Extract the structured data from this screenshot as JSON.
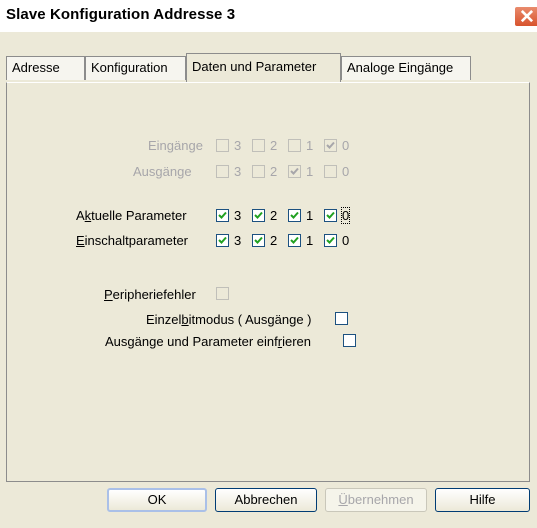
{
  "window": {
    "title": "Slave Konfiguration Addresse 3"
  },
  "tabs": [
    {
      "label": "Adresse",
      "active": false
    },
    {
      "label": "Konfiguration",
      "active": false
    },
    {
      "label": "Daten und Parameter",
      "active": true
    },
    {
      "label": "Analoge Eingänge",
      "active": false
    }
  ],
  "rows": {
    "eingaenge": {
      "label": "Eingänge",
      "enabled": false,
      "bits": [
        {
          "num": "3",
          "checked": false
        },
        {
          "num": "2",
          "checked": false
        },
        {
          "num": "1",
          "checked": false
        },
        {
          "num": "0",
          "checked": true
        }
      ]
    },
    "ausgaenge": {
      "label": "Ausgänge",
      "enabled": false,
      "bits": [
        {
          "num": "3",
          "checked": false
        },
        {
          "num": "2",
          "checked": true
        },
        {
          "num": "1",
          "checked": false
        },
        {
          "num": "0",
          "checked": false
        }
      ]
    },
    "aktuelle": {
      "label_pre": "A",
      "label_u": "k",
      "label_post": "tuelle Parameter",
      "enabled": true,
      "bits": [
        {
          "num": "3",
          "checked": true
        },
        {
          "num": "2",
          "checked": true
        },
        {
          "num": "1",
          "checked": true
        },
        {
          "num": "0",
          "checked": true
        }
      ]
    },
    "einschalt": {
      "label_u": "E",
      "label_post": "inschaltparameter",
      "enabled": true,
      "bits": [
        {
          "num": "3",
          "checked": true
        },
        {
          "num": "2",
          "checked": true
        },
        {
          "num": "1",
          "checked": true
        },
        {
          "num": "0",
          "checked": true
        }
      ]
    }
  },
  "options": {
    "peripherie": {
      "label_u": "P",
      "label_post": "eripheriefehler",
      "checked": false,
      "enabled": false
    },
    "einzelbit": {
      "label_pre": "Einzel",
      "label_u": "b",
      "label_post": "itmodus ( Ausgänge )",
      "checked": false,
      "enabled": true
    },
    "einfrieren": {
      "label_pre": "Ausgänge und Parameter einf",
      "label_u": "r",
      "label_post": "ieren",
      "checked": false,
      "enabled": true
    }
  },
  "buttons": {
    "ok": "OK",
    "cancel": "Abbrechen",
    "apply_u": "Ü",
    "apply_post": "bernehmen",
    "help": "Hilfe"
  },
  "colors": {
    "dialog_bg": "#ece9d8",
    "disabled_text": "#a7a6aa",
    "close_button": "#d8532d"
  },
  "icons": {
    "close": "close-icon",
    "check": "checkmark-icon"
  }
}
